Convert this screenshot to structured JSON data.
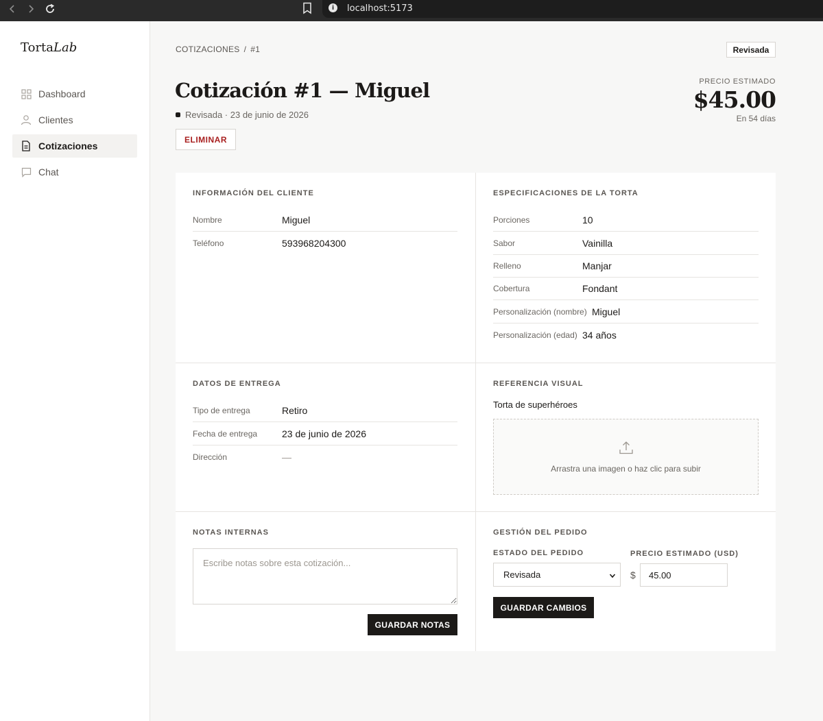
{
  "browser": {
    "url": "localhost:5173"
  },
  "app": {
    "logo_main": "Torta",
    "logo_italic": "Lab"
  },
  "sidebar": {
    "items": [
      {
        "label": "Dashboard",
        "icon": "grid-icon"
      },
      {
        "label": "Clientes",
        "icon": "user-icon"
      },
      {
        "label": "Cotizaciones",
        "icon": "document-icon",
        "active": true
      },
      {
        "label": "Chat",
        "icon": "chat-icon"
      }
    ]
  },
  "header": {
    "breadcrumb_root": "COTIZACIONES",
    "breadcrumb_sep": "/",
    "breadcrumb_current": "#1",
    "status_badge": "Revisada",
    "title": "Cotización #1 — Miguel",
    "subline": "Revisada · 23 de junio de 2026",
    "delete_label": "ELIMINAR",
    "price_label": "PRECIO ESTIMADO",
    "price_value": "$45.00",
    "price_sub": "En 54 días"
  },
  "client": {
    "title": "INFORMACIÓN DEL CLIENTE",
    "rows": [
      {
        "label": "Nombre",
        "value": "Miguel"
      },
      {
        "label": "Teléfono",
        "value": "593968204300"
      }
    ]
  },
  "cake": {
    "title": "ESPECIFICACIONES DE LA TORTA",
    "rows": [
      {
        "label": "Porciones",
        "value": "10"
      },
      {
        "label": "Sabor",
        "value": "Vainilla"
      },
      {
        "label": "Relleno",
        "value": "Manjar"
      },
      {
        "label": "Cobertura",
        "value": "Fondant"
      },
      {
        "label": "Personalización (nombre)",
        "value": "Miguel"
      },
      {
        "label": "Personalización (edad)",
        "value": "34 años"
      }
    ]
  },
  "delivery": {
    "title": "DATOS DE ENTREGA",
    "rows": [
      {
        "label": "Tipo de entrega",
        "value": "Retiro"
      },
      {
        "label": "Fecha de entrega",
        "value": "23 de junio de 2026"
      },
      {
        "label": "Dirección",
        "value": "—"
      }
    ]
  },
  "reference": {
    "title": "REFERENCIA VISUAL",
    "description": "Torta de superhéroes",
    "upload_text": "Arrastra una imagen o haz clic para subir"
  },
  "notes": {
    "title": "NOTAS INTERNAS",
    "placeholder": "Escribe notas sobre esta cotización...",
    "save_label": "GUARDAR NOTAS"
  },
  "management": {
    "title": "GESTIÓN DEL PEDIDO",
    "status_label": "ESTADO DEL PEDIDO",
    "status_value": "Revisada",
    "price_label": "PRECIO ESTIMADO (USD)",
    "currency": "$",
    "price_value": "45.00",
    "save_label": "GUARDAR CAMBIOS"
  }
}
